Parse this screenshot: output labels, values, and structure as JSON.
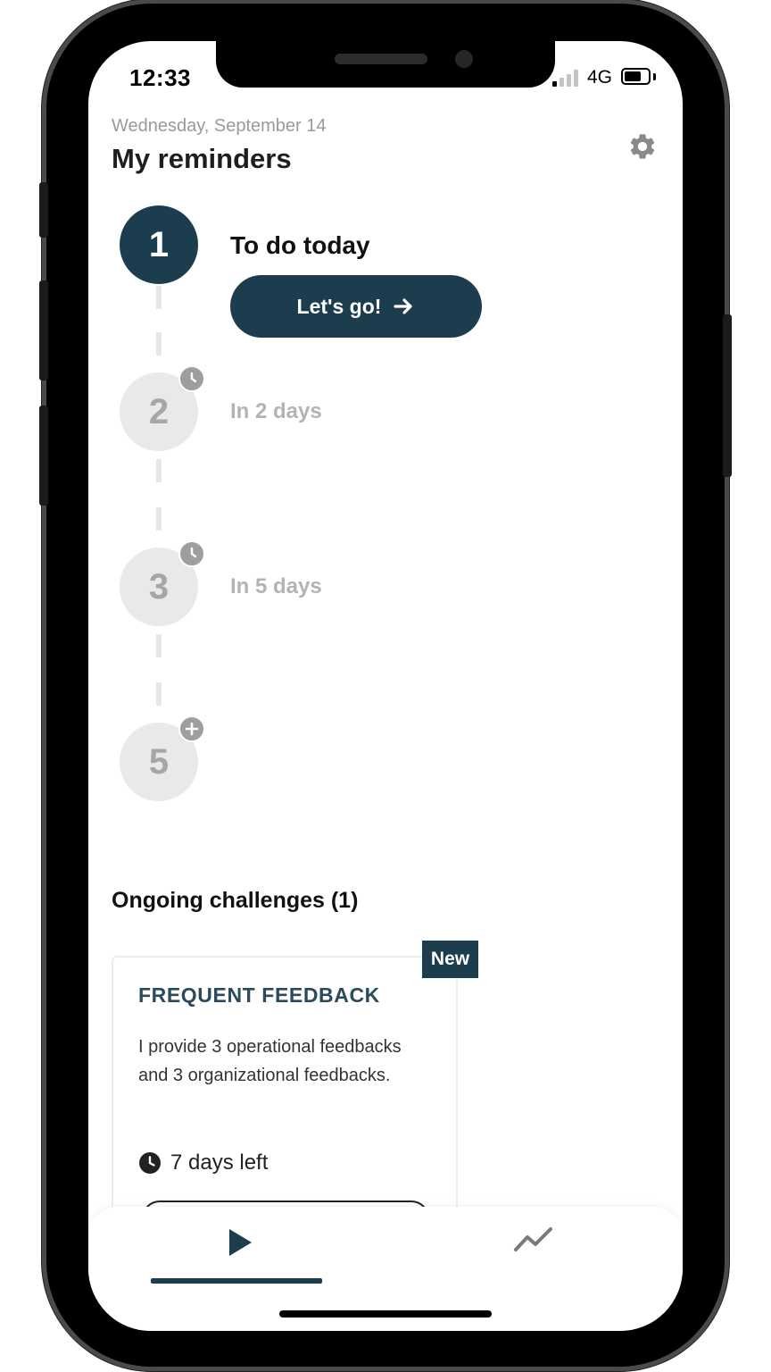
{
  "status_bar": {
    "time": "12:33",
    "network": "4G",
    "battery_level": 0.7
  },
  "header": {
    "date": "Wednesday, September 14",
    "title": "My reminders",
    "settings_icon": "gear-icon"
  },
  "steps": [
    {
      "number": "1",
      "label": "To do today",
      "state": "active",
      "button_label": "Let's go!",
      "button_icon": "arrow-right-icon"
    },
    {
      "number": "2",
      "label": "In 2 days",
      "state": "scheduled",
      "badge_icon": "clock-icon"
    },
    {
      "number": "3",
      "label": "In 5 days",
      "state": "scheduled",
      "badge_icon": "clock-icon"
    },
    {
      "number": "5",
      "label": "",
      "state": "add",
      "badge_icon": "plus-icon"
    }
  ],
  "challenges": {
    "title": "Ongoing challenges (1)",
    "items": [
      {
        "badge": "New",
        "title": "FREQUENT FEEDBACK",
        "description": "I provide 3 operational feedbacks and 3 organizational feedbacks.",
        "time_left": "7 days left"
      }
    ]
  },
  "bottom_nav": {
    "tabs": [
      "play-icon",
      "trend-chart-icon"
    ],
    "active_tab": 0
  },
  "colors": {
    "primary": "#1c3d4e",
    "inactive": "#e9e9e9",
    "muted_text": "#b3b3b3"
  }
}
